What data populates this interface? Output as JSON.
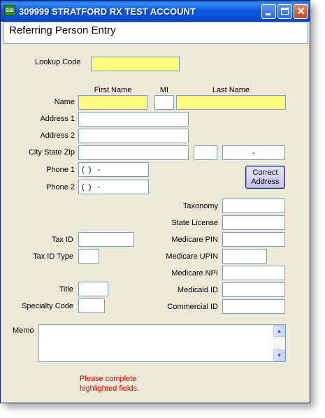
{
  "window": {
    "title": "309999 STRATFORD RX TEST ACCOUNT",
    "app_icon_text": "SSI"
  },
  "header": {
    "title": "Referring Person Entry"
  },
  "labels": {
    "lookup_code": "Lookup Code",
    "name": "Name",
    "first_name": "First Name",
    "mi": "MI",
    "last_name": "Last Name",
    "address1": "Address 1",
    "address2": "Address 2",
    "city_state_zip": "City State  Zip",
    "phone1": "Phone 1",
    "phone2": "Phone 2",
    "taxonomy": "Taxonomy",
    "state_license": "State License",
    "tax_id": "Tax ID",
    "medicare_pin": "Medicare PIN",
    "tax_id_type": "Tax ID Type",
    "medicare_upin": "Medicare UPIN",
    "medicare_npi": "Medicare NPI",
    "title": "Title",
    "medicaid_id": "Medicaid ID",
    "specialty_code": "Specialty Code",
    "commercial_id": "Commercial ID",
    "memo": "Memo"
  },
  "fields": {
    "lookup_code": "",
    "first_name": "",
    "mi": "",
    "last_name": "",
    "address1": "",
    "address2": "",
    "city": "",
    "state": "",
    "zip": "-",
    "phone1": "(  )   -",
    "phone2": "(  )   -",
    "taxonomy": "",
    "state_license": "",
    "tax_id": "",
    "medicare_pin": "",
    "tax_id_type": "",
    "medicare_upin": "",
    "medicare_npi": "",
    "title": "",
    "medicaid_id": "",
    "specialty_code": "",
    "commercial_id": "",
    "memo": ""
  },
  "buttons": {
    "correct_address_line1": "Correct",
    "correct_address_line2": "Address"
  },
  "warning": {
    "line1": "Please complete",
    "line2": "highlighted fields."
  },
  "colors": {
    "required_field": "#ffff80",
    "warning_text": "#cc0000",
    "titlebar": "#0b5ae0"
  }
}
